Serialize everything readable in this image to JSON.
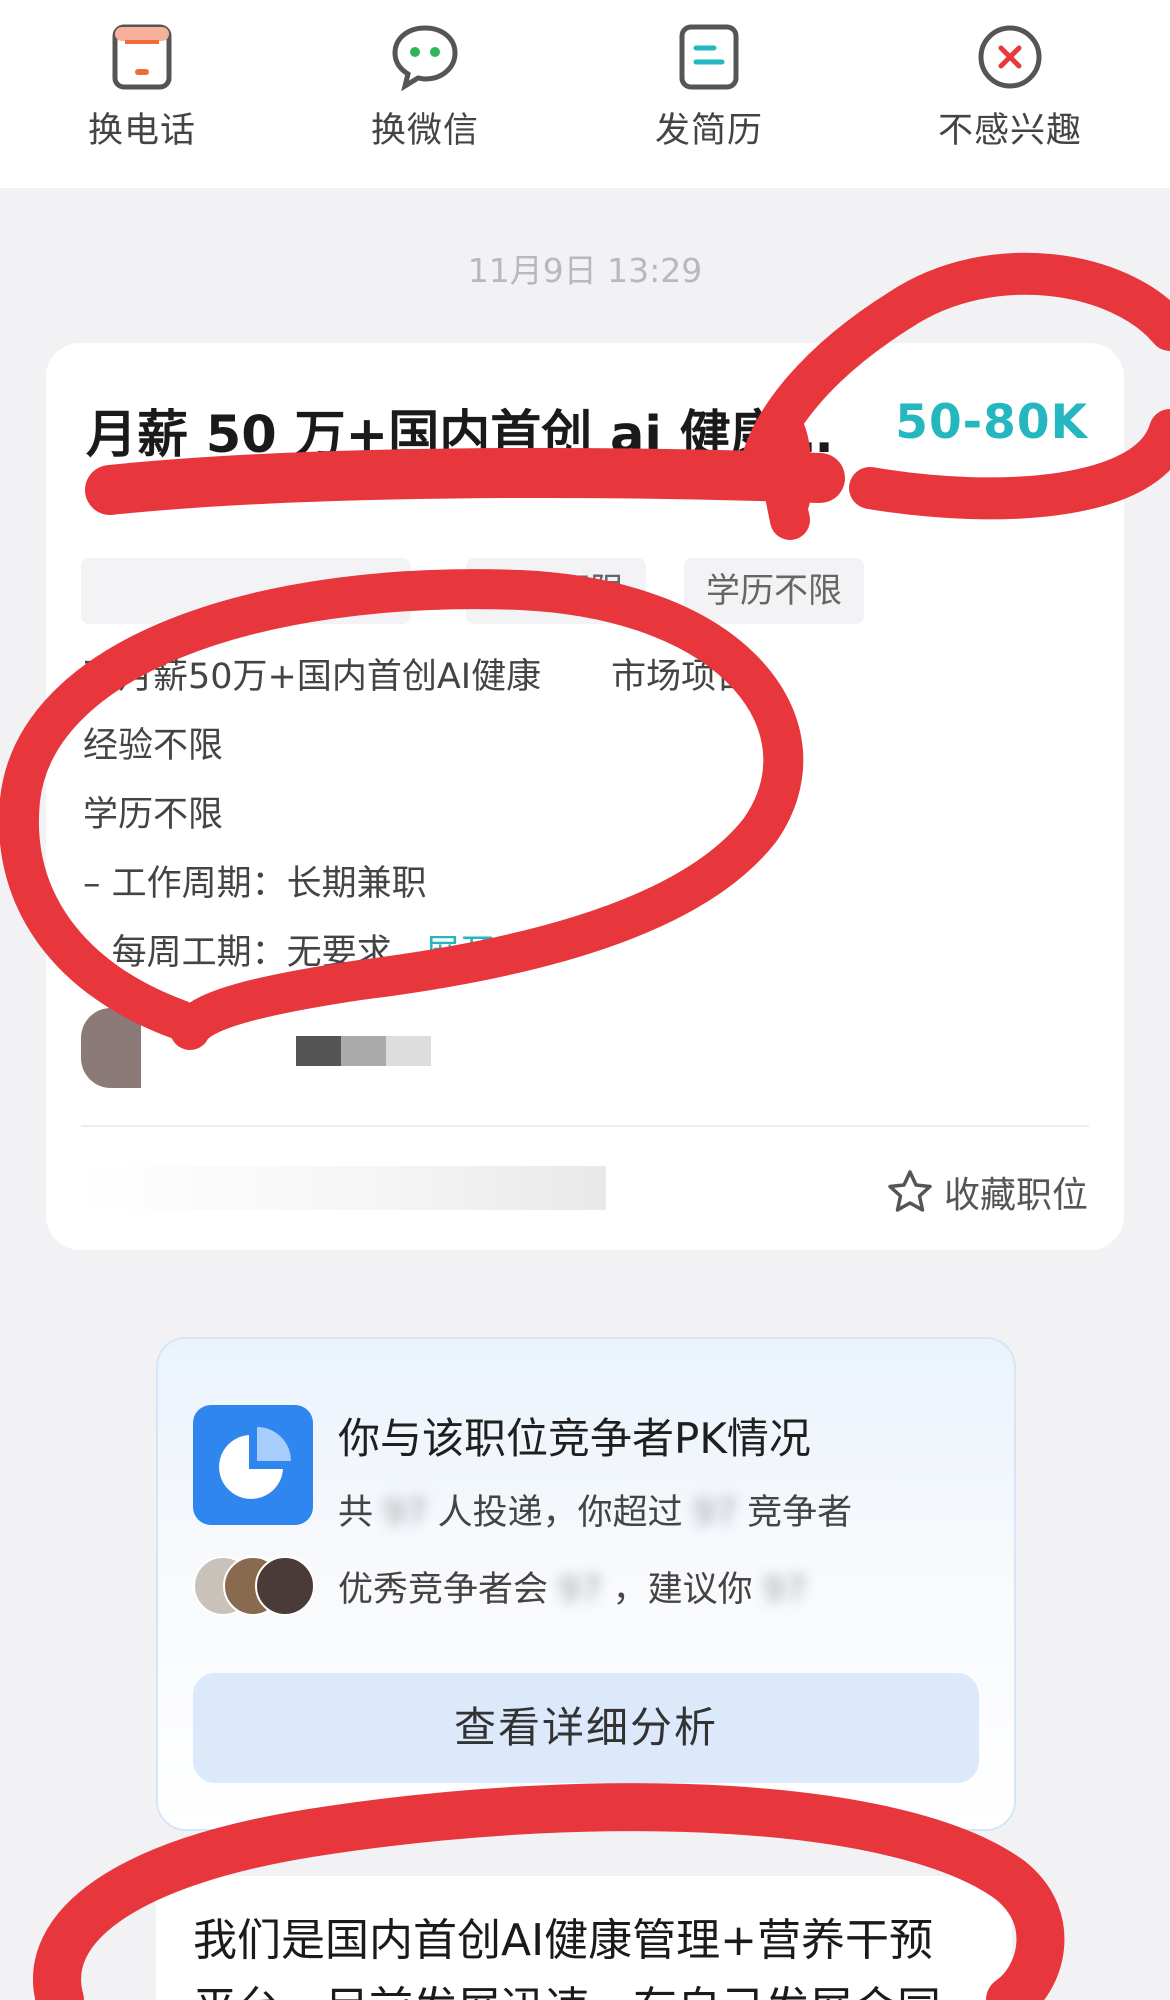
{
  "actions": [
    {
      "label": "换电话",
      "icon": "phone-icon"
    },
    {
      "label": "换微信",
      "icon": "wechat-icon"
    },
    {
      "label": "发简历",
      "icon": "resume-icon"
    },
    {
      "label": "不感兴趣",
      "icon": "close-circle-icon"
    }
  ],
  "timestamp": "11月9日 13:29",
  "job": {
    "title": "月薪 50 万+国内首创 ai 健康…",
    "salary": "50-80K",
    "tags": [
      "经验不限",
      "学历不限"
    ],
    "description": [
      "可月薪50万+国内首创AI健康",
      "经验不限",
      "学历不限",
      "– 工作周期：长期兼职",
      "– 每周工期：无要求.."
    ],
    "desc_suffix": "市场项目",
    "expand_label": "展开",
    "collect_label": "收藏职位"
  },
  "pk": {
    "title": "你与该职位竞争者PK情况",
    "line1_prefix": "共",
    "line1_mid": "人投递，你超过",
    "line1_suffix": "竞争者",
    "line2_prefix": "优秀竞争者会",
    "line2_mid": "，建议你",
    "button": "查看详细分析",
    "blurred": "97"
  },
  "message": {
    "line1": "我们是国内首创AI健康管理+营养干预",
    "line2": "平台，目前发展迅速，有自己发展合同"
  },
  "colors": {
    "accent": "#25b7bf",
    "pk_blue": "#2f86ee",
    "scribble_red": "#e8363d",
    "close_red": "#e5393e",
    "wechat_green": "#2fb55a",
    "phone_orange": "#f26b3a"
  }
}
